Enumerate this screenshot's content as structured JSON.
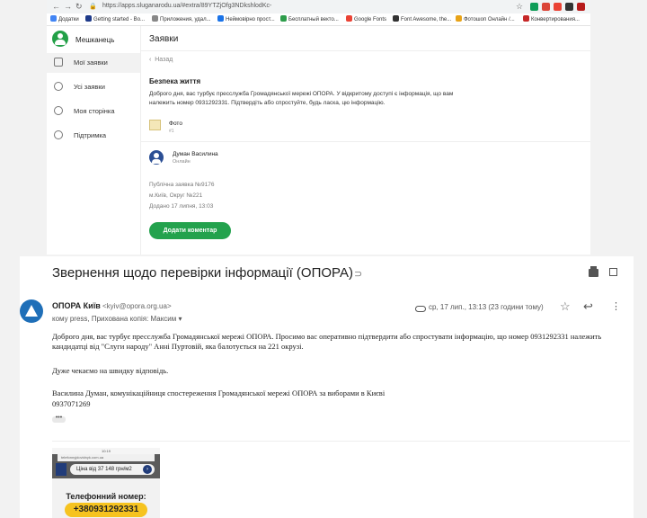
{
  "browser": {
    "url": "https://apps.sluganarodu.ua/#extra/89YTZjOfg3NDkshlodKc-",
    "bookmarks": [
      {
        "label": "Додатки",
        "color": "#4285f4"
      },
      {
        "label": "Getting started - Bo...",
        "color": "#1e3a8a"
      },
      {
        "label": "Приложения, удал...",
        "color": "#888888"
      },
      {
        "label": "Неймовірно прост...",
        "color": "#1a73e8"
      },
      {
        "label": "Бесплатный векто...",
        "color": "#2e9d4b"
      },
      {
        "label": "Google Fonts",
        "color": "#ea4335"
      },
      {
        "label": "Font Awesome, the...",
        "color": "#333333"
      },
      {
        "label": "Фотошоп Онлайн /...",
        "color": "#e8a317"
      },
      {
        "label": "Конвертирования...",
        "color": "#c62828"
      }
    ],
    "extension_colors": [
      "#0f9d58",
      "#db4437",
      "#ea4335",
      "#333333",
      "#b71c1c"
    ]
  },
  "app": {
    "sidebar": {
      "title": "Мешканець",
      "items": [
        {
          "label": "Мої заявки",
          "icon": "document-icon"
        },
        {
          "label": "Усі заявки",
          "icon": "users-icon"
        },
        {
          "label": "Моя сторінка",
          "icon": "gear-icon"
        },
        {
          "label": "Підтримка",
          "icon": "support-icon"
        }
      ]
    },
    "header": {
      "title": "Заявки",
      "back": "Назад"
    },
    "card": {
      "title": "Безпека життя",
      "body": "Доброго дня, вас турбує пресслужба Громадянської мережі ОПОРА. У відкритому доступі є інформація, що вам належить номер 0931292331. Підтвердіть або спростуйте, будь ласка, цю інформацію.",
      "photo_label": "Фото",
      "photo_sub": "#1",
      "author_name": "Думан Василина",
      "author_status": "Онлайн",
      "meta_lines": [
        "Публічна заявка №9176",
        "м.Київ, Округ №221",
        "Додано 17 липня, 13:03"
      ],
      "button": "Додати коментар"
    },
    "accent": "#23a24d"
  },
  "mail": {
    "subject": "Звернення щодо перевірки інформації (ОПОРА)",
    "sender_name": "ОПОРА Київ",
    "sender_email": "<kyiv@opora.org.ua>",
    "recipients": "кому press, Прихована копія: Максим",
    "date": "ср, 17 лип., 13:13 (23 години тому)",
    "paragraphs": [
      "Доброго дня, вас турбує пресслужба Громадянської мережі ОПОРА. Просимо вас оперативно підтвердити або спростувати інформацію, що номер 0931292331 належить кандидатці від \"Слуги народу\" Анні Пуртовій, яка балотується на 221 окрузі.",
      "Дуже чекаємо на швидку відповідь.",
      "Василина Думан, комунікаційниця спостереження Громадянської мережі ОПОРА за виборами в Києві",
      "0937071269"
    ],
    "ellipsis": "•••",
    "attachment": {
      "status": "10:19",
      "url": "telefonnyjdovidnyk.com.ua",
      "price": "Ціна від 37 148 грн/м2",
      "label": "Телефонний номер:",
      "number": "+380931292331"
    },
    "accent": "#1f6fb8"
  }
}
